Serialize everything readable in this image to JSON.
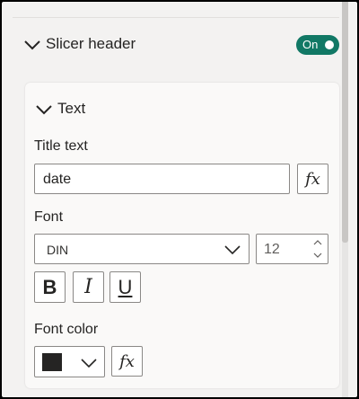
{
  "section": {
    "title": "Slicer header",
    "toggle_label": "On"
  },
  "card": {
    "title": "Text",
    "title_text_label": "Title text",
    "title_text_value": "date",
    "font_label": "Font",
    "font_family": "DIN",
    "font_size": "12",
    "font_color_label": "Font color",
    "fx_label": "fx",
    "bold_glyph": "B",
    "italic_glyph": "I",
    "underline_glyph": "U"
  },
  "colors": {
    "toggle_on": "#117865",
    "font_color": "#252423"
  }
}
